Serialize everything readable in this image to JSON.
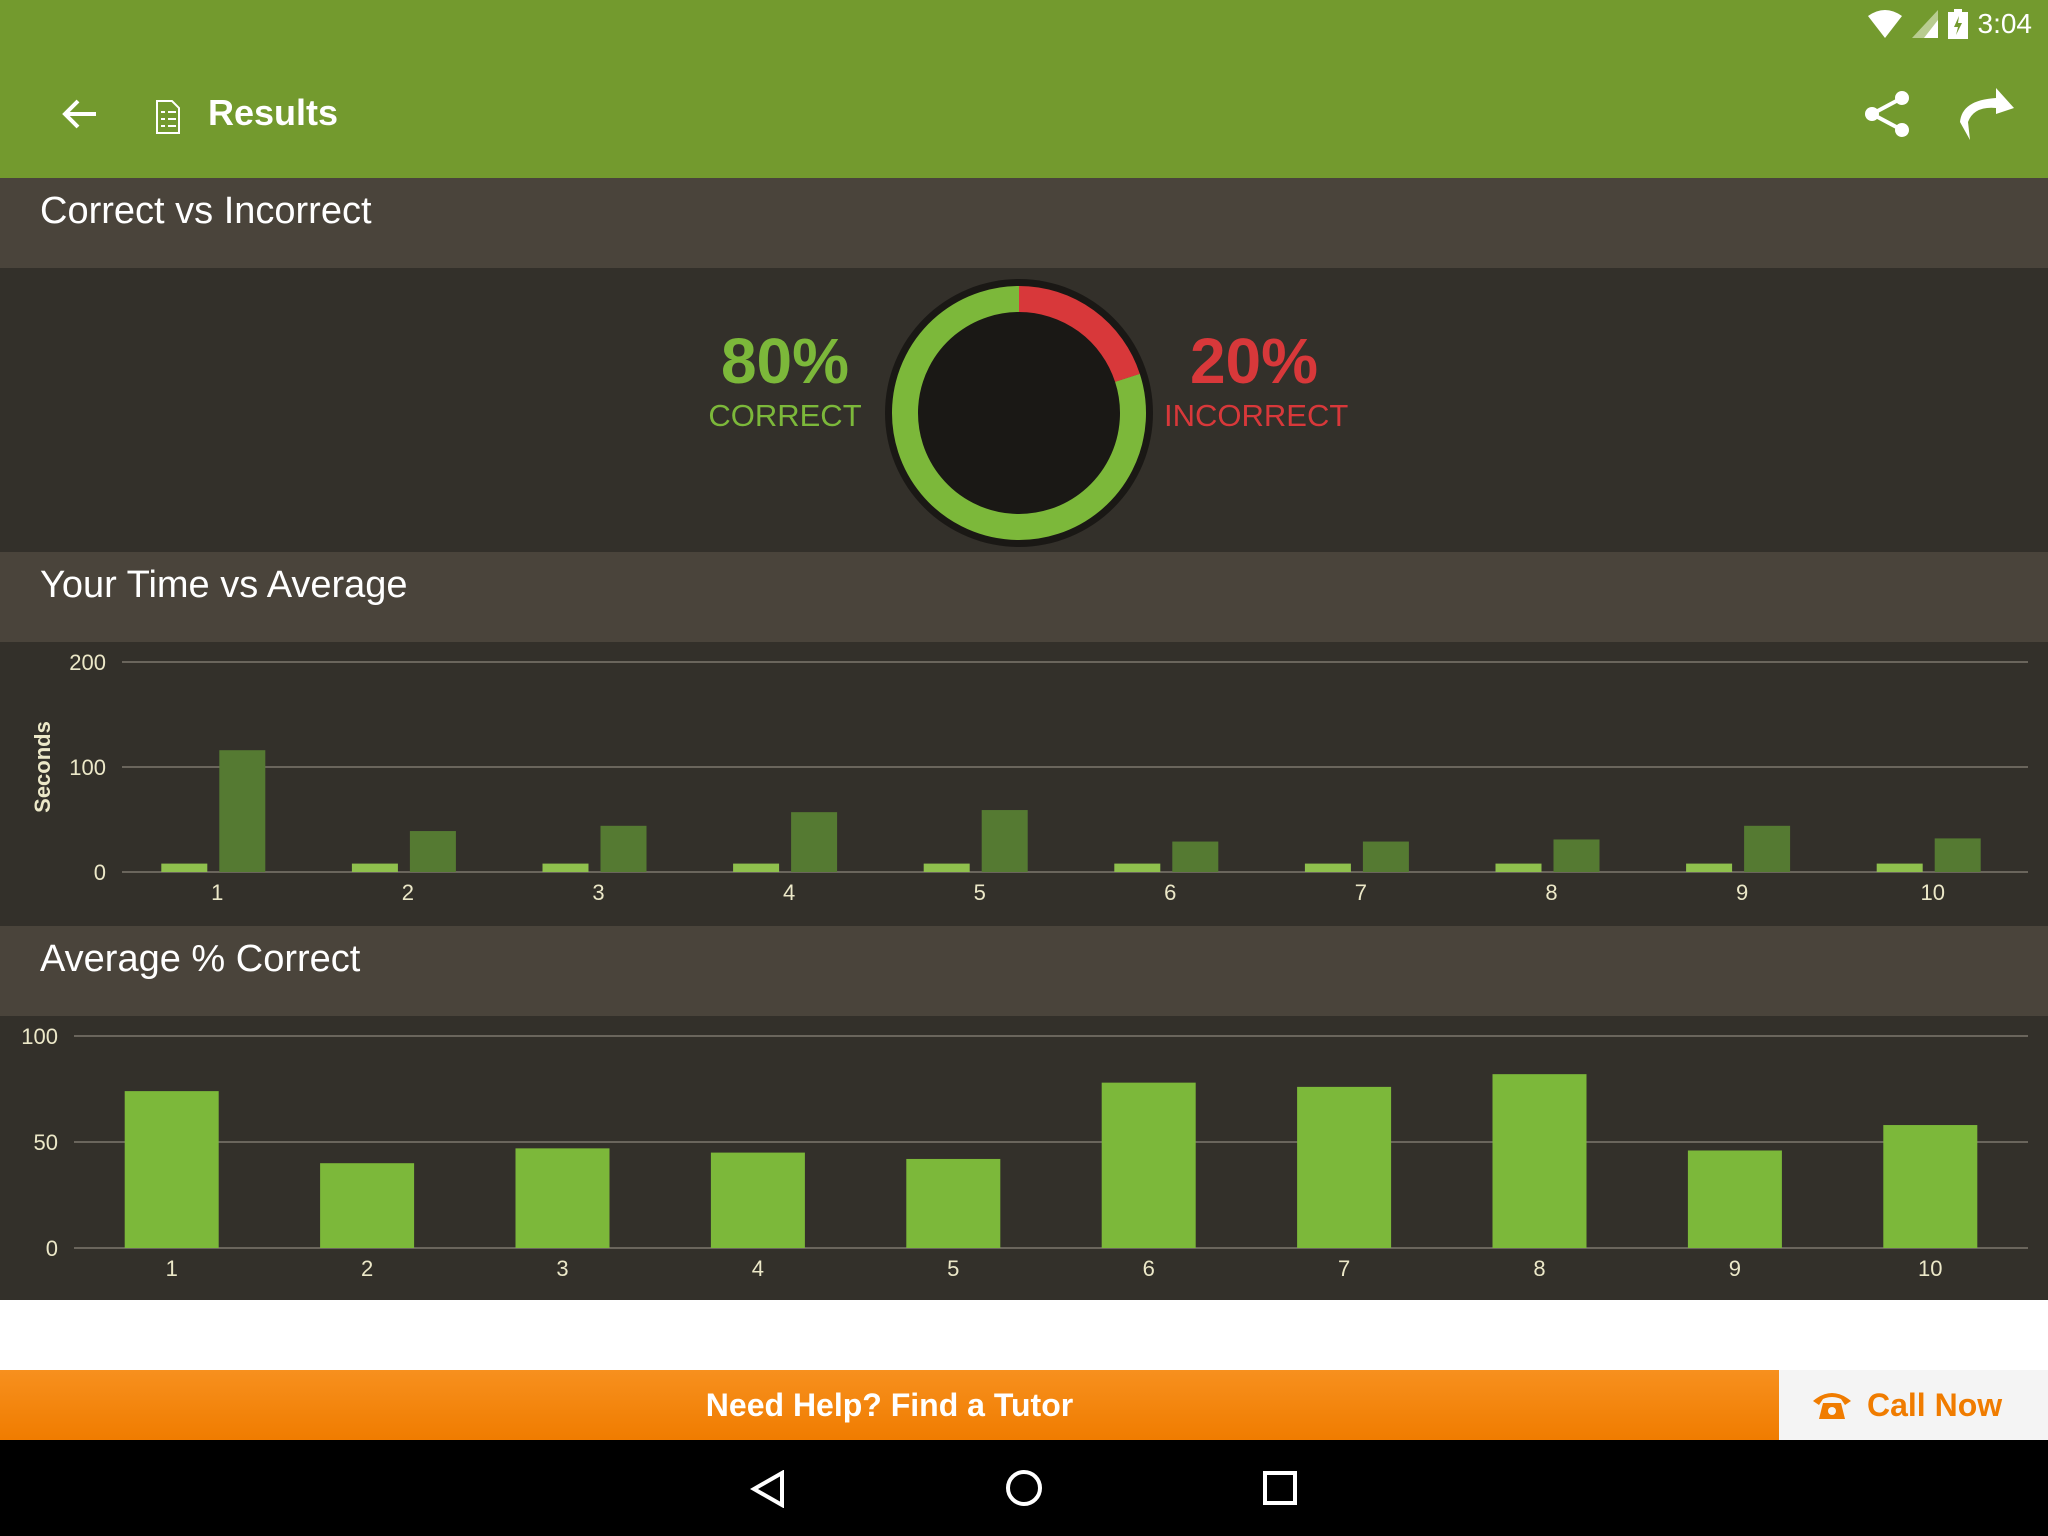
{
  "status_bar": {
    "time": "3:04",
    "icons": [
      "wifi-icon",
      "signal-icon",
      "battery-charging-icon"
    ]
  },
  "app_bar": {
    "title": "Results",
    "icons": [
      "back-arrow-icon",
      "document-checklist-icon",
      "share-icon",
      "forward-arrow-icon"
    ],
    "color": "#739a2e"
  },
  "sections": {
    "correct": {
      "title": "Correct vs Incorrect",
      "correct_value": "80%",
      "correct_label": "CORRECT",
      "incorrect_value": "20%",
      "incorrect_label": "INCORRECT",
      "correct_color": "#7cb83a",
      "incorrect_color": "#d8383a"
    },
    "time": {
      "title": "Your Time vs Average"
    },
    "avg": {
      "title": "Average % Correct"
    }
  },
  "chart_data": [
    {
      "type": "pie",
      "variant": "donut",
      "slices": [
        {
          "label": "CORRECT",
          "value": 80,
          "color": "#7cb83a"
        },
        {
          "label": "INCORRECT",
          "value": 20,
          "color": "#d8383a"
        }
      ]
    },
    {
      "type": "bar",
      "ylabel": "Seconds",
      "ylim": [
        0,
        200
      ],
      "yticks": [
        "0",
        "100",
        "200"
      ],
      "grid": true,
      "categories": [
        "1",
        "2",
        "3",
        "4",
        "5",
        "6",
        "7",
        "8",
        "9",
        "10"
      ],
      "series": [
        {
          "values": [
            8,
            8,
            8,
            8,
            8,
            8,
            8,
            8,
            8,
            8
          ],
          "color": "#8fc04d"
        },
        {
          "values": [
            116,
            39,
            44,
            57,
            59,
            29,
            29,
            31,
            44,
            32
          ],
          "color": "#557a32"
        }
      ]
    },
    {
      "type": "bar",
      "ylim": [
        0,
        100
      ],
      "yticks": [
        "0",
        "50",
        "100"
      ],
      "grid": true,
      "categories": [
        "1",
        "2",
        "3",
        "4",
        "5",
        "6",
        "7",
        "8",
        "9",
        "10"
      ],
      "series": [
        {
          "values": [
            74,
            40,
            47,
            45,
            42,
            78,
            76,
            82,
            46,
            58
          ],
          "color": "#7cb83a"
        }
      ]
    }
  ],
  "footer": {
    "tutor_label": "Need Help? Find a Tutor",
    "call_label": "Call Now",
    "call_icon": "phone-icon"
  },
  "nav_bar": {
    "icons": [
      "back-triangle-icon",
      "home-circle-icon",
      "recents-square-icon"
    ]
  }
}
